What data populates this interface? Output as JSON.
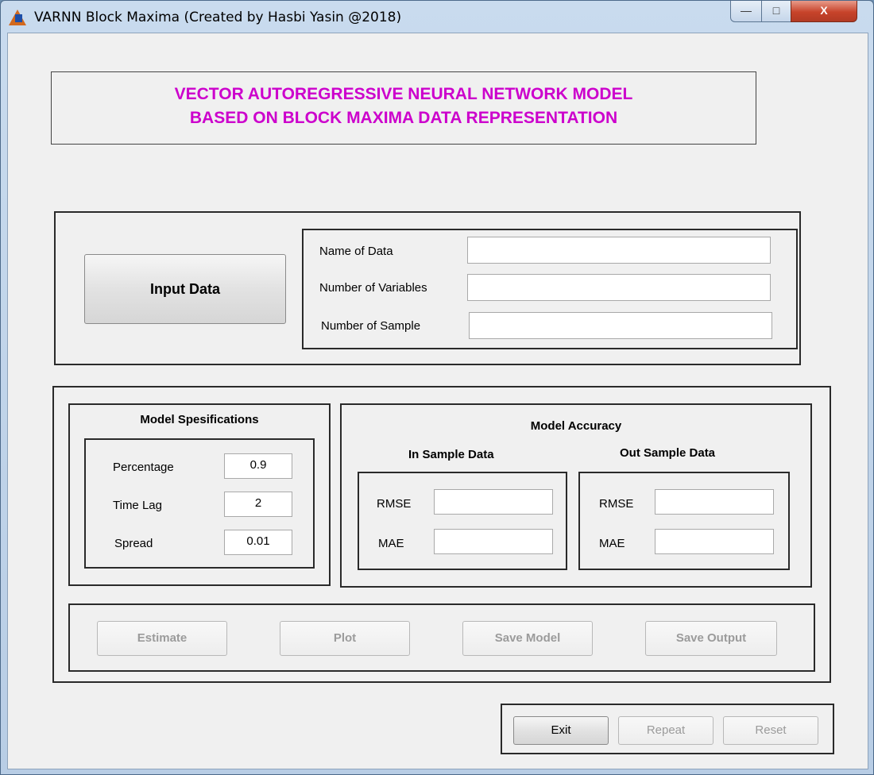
{
  "window": {
    "title": "VARNN Block Maxima (Created by Hasbi Yasin @2018)",
    "minimize_label": "—",
    "maximize_label": "□",
    "close_label": "X"
  },
  "header": {
    "line1": "VECTOR AUTOREGRESSIVE NEURAL NETWORK MODEL",
    "line2": "BASED ON BLOCK MAXIMA DATA REPRESENTATION",
    "color": "#cc00cc"
  },
  "input_panel": {
    "button_label": "Input Data",
    "name_label": "Name of Data",
    "name_value": "",
    "variables_label": "Number of Variables",
    "variables_value": "",
    "sample_label": "Number of Sample",
    "sample_value": ""
  },
  "spec": {
    "title": "Model Spesifications",
    "percentage_label": "Percentage",
    "percentage_value": "0.9",
    "lag_label": "Time Lag",
    "lag_value": "2",
    "spread_label": "Spread",
    "spread_value": "0.01"
  },
  "accuracy": {
    "title": "Model Accuracy",
    "in_title": "In Sample Data",
    "out_title": "Out Sample Data",
    "rmse_label": "RMSE",
    "mae_label": "MAE",
    "in_rmse": "",
    "in_mae": "",
    "out_rmse": "",
    "out_mae": ""
  },
  "actions": {
    "estimate": "Estimate",
    "plot": "Plot",
    "save_model": "Save Model",
    "save_output": "Save Output"
  },
  "footer": {
    "exit": "Exit",
    "repeat": "Repeat",
    "reset": "Reset"
  }
}
